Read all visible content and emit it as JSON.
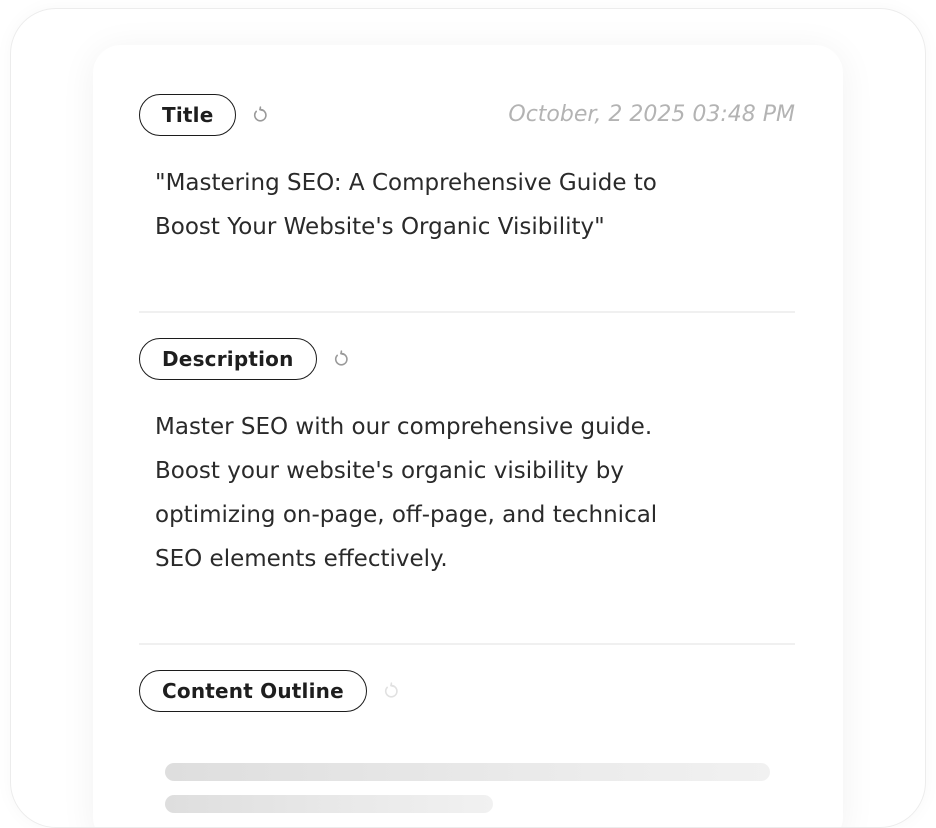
{
  "title_section": {
    "label": "Title",
    "timestamp": "October, 2 2025 03:48 PM",
    "text_lines": [
      "\"Mastering SEO: A Comprehensive Guide to",
      "Boost Your Website's Organic Visibility\""
    ]
  },
  "description_section": {
    "label": "Description",
    "text_lines": [
      "Master SEO with our comprehensive guide.",
      "Boost your website's organic visibility by",
      "optimizing on-page, off-page, and technical",
      "SEO elements effectively."
    ]
  },
  "outline_section": {
    "label": "Content Outline",
    "loading": true
  },
  "icons": {
    "regenerate": "refresh-icon"
  },
  "colors": {
    "text": "#2a2a2a",
    "pill_border": "#1c1c1c",
    "timestamp": "#b3b3b3",
    "skeleton": "#dedede"
  }
}
